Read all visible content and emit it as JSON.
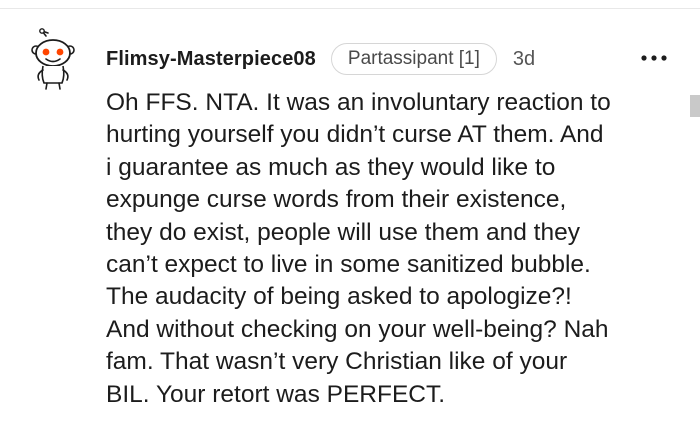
{
  "comment": {
    "author": "Flimsy-Masterpiece08",
    "flair": "Partassipant [1]",
    "age": "3d",
    "avatar_icon": "reddit-snoo-avatar-icon",
    "more_icon": "more-options-icon",
    "body": "Oh FFS. NTA. It was an involuntary reaction to\nhurting yourself you didn’t curse AT them. And\ni guarantee as much as they would like to\nexpunge curse words from their existence,\nthey do exist, people will use them and they\ncan’t expect to live in some sanitized bubble.\nThe audacity of being asked to apologize?!\nAnd without checking on your well-being? Nah\nfam. That wasn’t very Christian like of your\nBIL. Your retort was PERFECT."
  },
  "colors": {
    "text": "#1c1c1c",
    "muted": "#555555",
    "flair_border": "#d6d6d6",
    "avatar_accent": "#ff4500"
  }
}
